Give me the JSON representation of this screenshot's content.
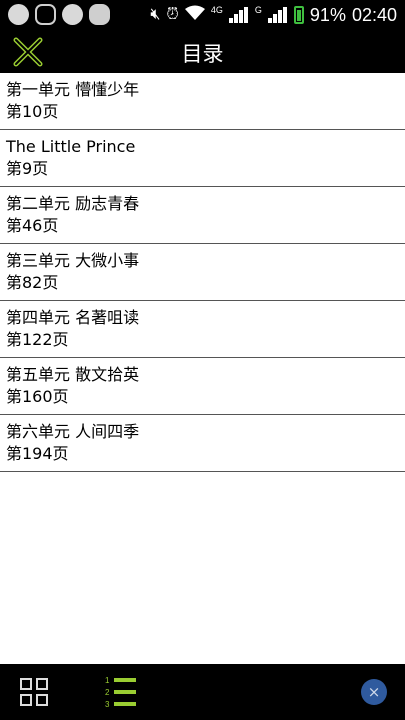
{
  "status_bar": {
    "network_4g": "4G",
    "network_g": "G",
    "battery_percent": "91%",
    "time": "02:40",
    "icons": [
      "app-icon",
      "chat-bubble-icon",
      "app-icon",
      "wechat-icon",
      "mute-icon",
      "alarm-icon",
      "wifi-icon",
      "signal-icon",
      "battery-icon"
    ]
  },
  "header": {
    "title": "目录"
  },
  "toc": [
    {
      "title": "第一单元 懵懂少年",
      "page": "第10页"
    },
    {
      "title": "The Little Prince",
      "page": "第9页"
    },
    {
      "title": "第二单元 励志青春",
      "page": "第46页"
    },
    {
      "title": "第三单元 大微小事",
      "page": "第82页"
    },
    {
      "title": "第四单元 名著咀读",
      "page": "第122页"
    },
    {
      "title": "第五单元 散文拾英",
      "page": "第160页"
    },
    {
      "title": "第六单元 人间四季",
      "page": "第194页"
    }
  ],
  "bottom_bar": {
    "list_numbers": [
      "1",
      "2",
      "3"
    ],
    "close_glyph": "×"
  },
  "colors": {
    "bar_background": "#000000",
    "accent_green": "#9acd32",
    "close_blue": "#2f5a9e"
  }
}
